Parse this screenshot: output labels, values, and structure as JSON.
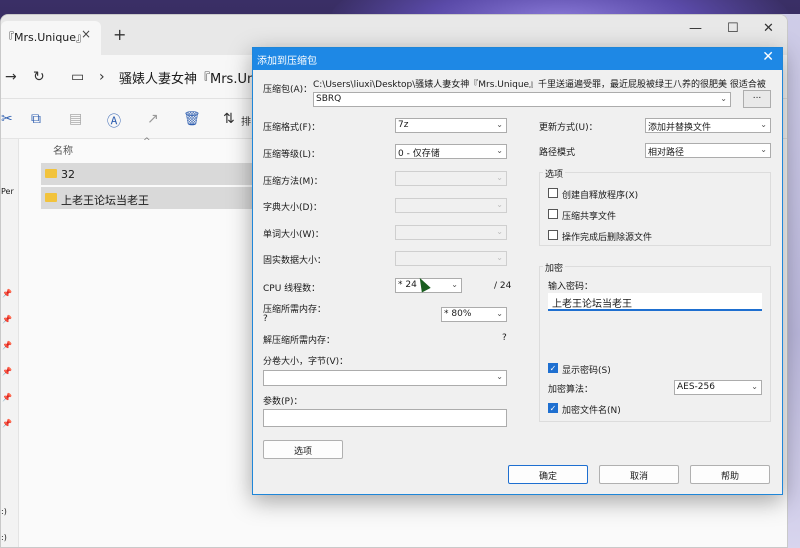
{
  "explorer": {
    "tab_title": "『Mrs.Unique』",
    "tab_close": "×",
    "new_tab": "+",
    "breadcrumb_path": "骚婊人妻女神『Mrs.Unique",
    "sort_label": "排",
    "column_name": "名称",
    "files": [
      "32",
      "上老王论坛当老王"
    ],
    "left_frag_per": "Per",
    "left_frag_drive1": ":)",
    "left_frag_drive2": ":)"
  },
  "dialog": {
    "title": "添加到压缩包",
    "archive_label": "压缩包(A)：",
    "archive_path": "C:\\Users\\liuxi\\Desktop\\骚婊人妻女神『Mrs.Unique』千里送逼遍受罪，最近屁股被绿王八养的很肥美 很适合被",
    "archive_name": "SBRQ",
    "browse_label": "...",
    "format_label": "压缩格式(F)：",
    "format_value": "7z",
    "level_label": "压缩等级(L)：",
    "level_value": "0 - 仅存储",
    "method_label": "压缩方法(M)：",
    "dict_label": "字典大小(D)：",
    "word_label": "单词大小(W)：",
    "solid_label": "固实数据大小：",
    "threads_label": "CPU 线程数：",
    "threads_value": "* 24",
    "threads_total": "/ 24",
    "mem_compress_label": "压缩所需内存：",
    "mem_q": "?",
    "mem_value": "* 80%",
    "mem_decompress_label": "解压缩所需内存：",
    "mem_decompress_value": "?",
    "split_label": "分卷大小，字节(V)：",
    "params_label": "参数(P)：",
    "options_button": "选项",
    "update_label": "更新方式(U)：",
    "update_value": "添加并替换文件",
    "pathmode_label": "路径模式",
    "pathmode_value": "相对路径",
    "options_group": "选项",
    "opt_sfx": "创建自释放程序(X)",
    "opt_shared": "压缩共享文件",
    "opt_delete": "操作完成后删除源文件",
    "enc_group": "加密",
    "enc_pwd_label": "输入密码：",
    "enc_pwd_value": "上老王论坛当老王",
    "show_pwd": "显示密码(S)",
    "enc_method_label": "加密算法：",
    "enc_method_value": "AES-256",
    "enc_names": "加密文件名(N)",
    "ok": "确定",
    "cancel": "取消",
    "help": "帮助",
    "close": "✕"
  },
  "colors": {
    "accent": "#1e88e5",
    "folder": "#f2c33c"
  }
}
